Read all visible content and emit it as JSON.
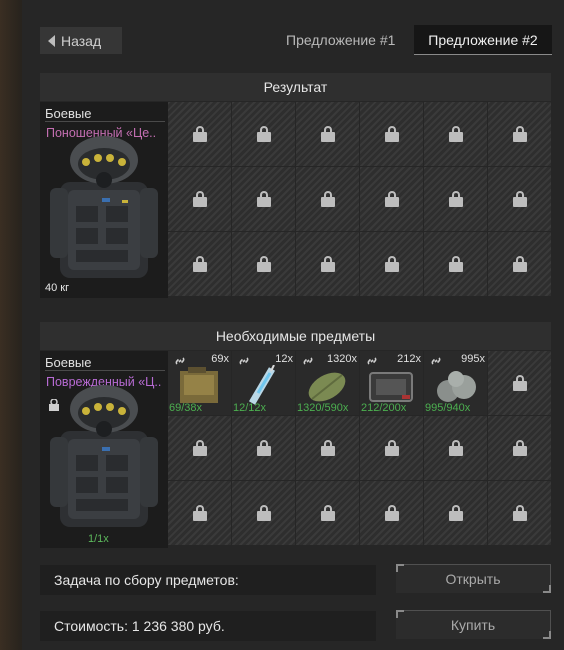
{
  "header": {
    "back_label": "Назад",
    "tabs": [
      {
        "label": "Предложение #1",
        "active": false
      },
      {
        "label": "Предложение #2",
        "active": true
      }
    ]
  },
  "result": {
    "title": "Результат",
    "item": {
      "category": "Боевые",
      "name": "Поношенный «Це..",
      "weight": "40 кг"
    }
  },
  "required": {
    "title": "Необходимые предметы",
    "item": {
      "category": "Боевые",
      "name": "Поврежденный «Ц..",
      "count": "1/1x"
    },
    "materials": [
      {
        "qty": "69x",
        "have": "69/38x",
        "icon": "document-folder-icon"
      },
      {
        "qty": "12x",
        "have": "12/12x",
        "icon": "syringe-icon"
      },
      {
        "qty": "1320x",
        "have": "1320/590x",
        "icon": "leaf-icon"
      },
      {
        "qty": "212x",
        "have": "212/200x",
        "icon": "device-case-icon"
      },
      {
        "qty": "995x",
        "have": "995/940x",
        "icon": "rock-pile-icon"
      }
    ]
  },
  "footer": {
    "task_label": "Задача по сбору предметов:",
    "cost_label": "Стоимость: 1 236 380 руб.",
    "open_label": "Открыть",
    "buy_label": "Купить"
  },
  "colors": {
    "have_green": "#4caf50",
    "name_pink": "#c46fb2",
    "name_purple": "#b86bd4"
  }
}
